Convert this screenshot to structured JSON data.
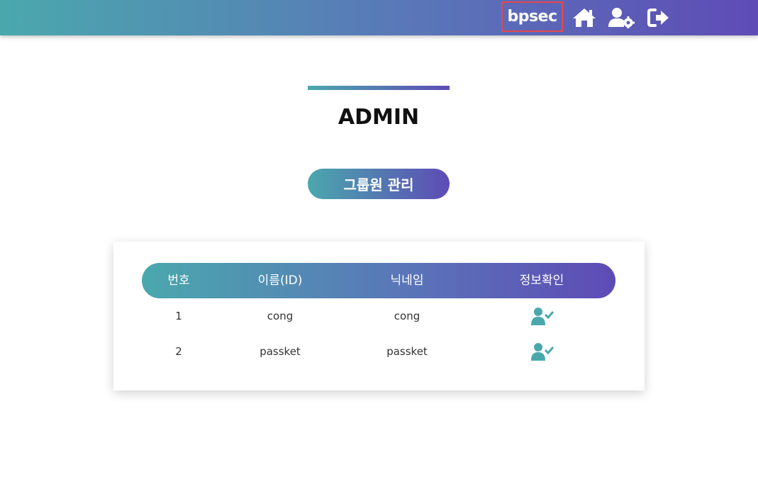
{
  "header": {
    "username": "bpsec",
    "icons": [
      "home-icon",
      "user-settings-icon",
      "logout-icon"
    ],
    "gradient_start": "#4aa8ad",
    "gradient_end": "#5e4bb6"
  },
  "main": {
    "title": "ADMIN",
    "group_button_label": "그룹원 관리"
  },
  "table": {
    "headers": [
      "번호",
      "이름(ID)",
      "닉네임",
      "정보확인"
    ],
    "rows": [
      {
        "no": "1",
        "id": "cong",
        "nickname": "cong",
        "action_icon": "user-check-icon"
      },
      {
        "no": "2",
        "id": "passket",
        "nickname": "passket",
        "action_icon": "user-check-icon"
      }
    ],
    "icon_color": "#4aa8ad"
  }
}
